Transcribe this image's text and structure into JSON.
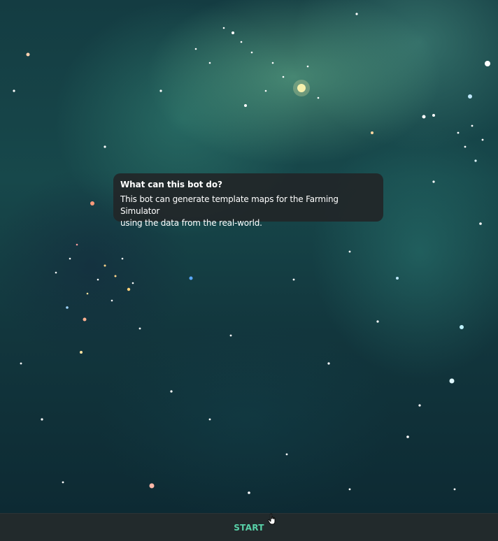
{
  "info_bubble": {
    "title": "What can this bot do?",
    "description_line1": "This bot can generate template maps for the Farming Simulator",
    "description_line2": "using the data from the real-world."
  },
  "bottom_bar": {
    "start_label": "START",
    "start_color": "#58d1a8",
    "bar_color": "#222a2c"
  },
  "background": {
    "description": "space-nebula-wallpaper",
    "accent_color": "#1f5a55"
  },
  "icons": {
    "cursor": "hand-pointer-icon"
  }
}
